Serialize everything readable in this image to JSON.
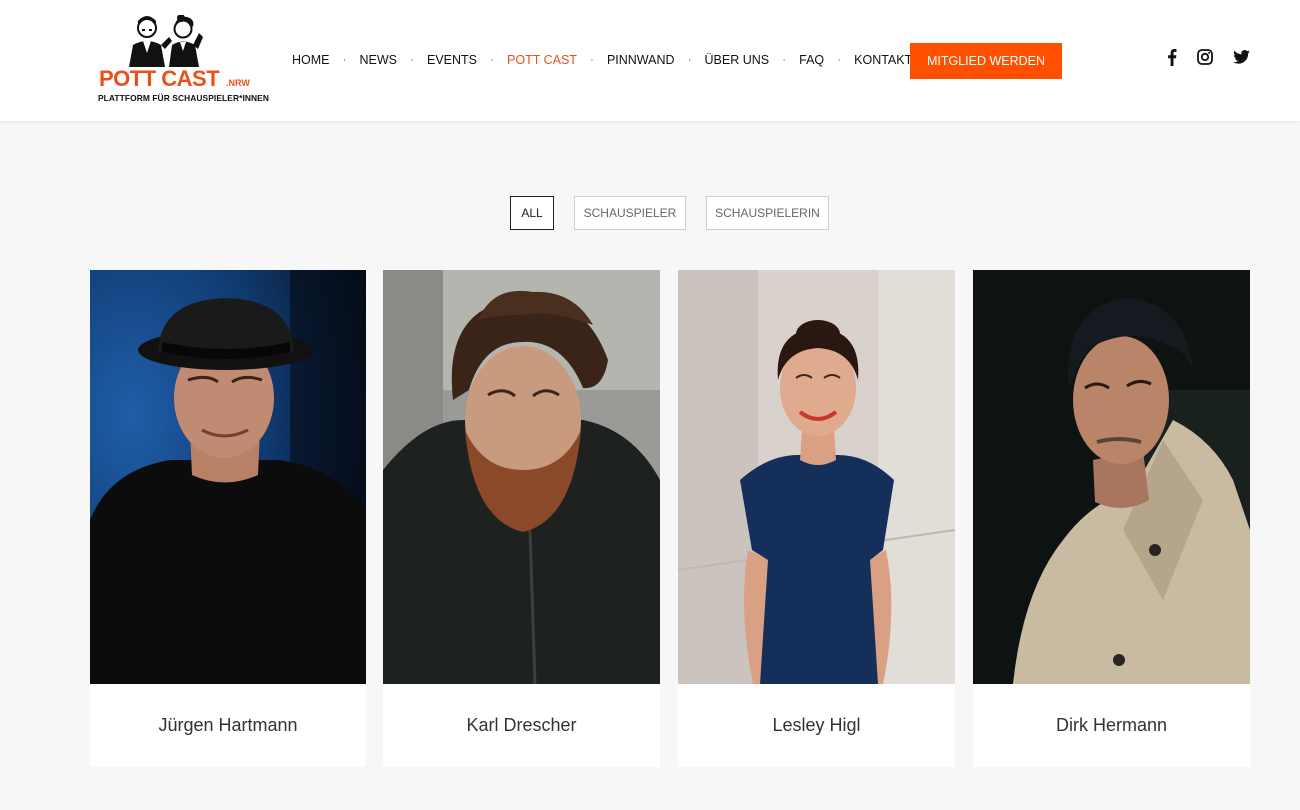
{
  "header": {
    "logo": {
      "wordmark": "POTT CAST",
      "suffix": ".NRW",
      "tagline": "PLATTFORM FÜR SCHAUSPIELER*INNEN"
    },
    "nav": [
      {
        "label": "HOME",
        "active": false
      },
      {
        "label": "NEWS",
        "active": false
      },
      {
        "label": "EVENTS",
        "active": false
      },
      {
        "label": "POTT CAST",
        "active": true
      },
      {
        "label": "PINNWAND",
        "active": false
      },
      {
        "label": "ÜBER UNS",
        "active": false
      },
      {
        "label": "FAQ",
        "active": false
      },
      {
        "label": "KONTAKT",
        "active": false
      }
    ],
    "nav_separator": "·",
    "cta_label": "MITGLIED WERDEN",
    "social": [
      {
        "icon": "facebook-icon"
      },
      {
        "icon": "instagram-icon"
      },
      {
        "icon": "twitter-icon"
      }
    ]
  },
  "filters": [
    {
      "label": "ALL",
      "active": true
    },
    {
      "label": "SCHAUSPIELER",
      "active": false
    },
    {
      "label": "SCHAUSPIELERIN",
      "active": false
    }
  ],
  "members": [
    {
      "name": "Jürgen Hartmann"
    },
    {
      "name": "Karl Drescher"
    },
    {
      "name": "Lesley Higl"
    },
    {
      "name": "Dirk Hermann"
    }
  ],
  "colors": {
    "accent": "#e8501c",
    "cta_background": "#ff4f00",
    "page_background": "#f7f7f7"
  }
}
